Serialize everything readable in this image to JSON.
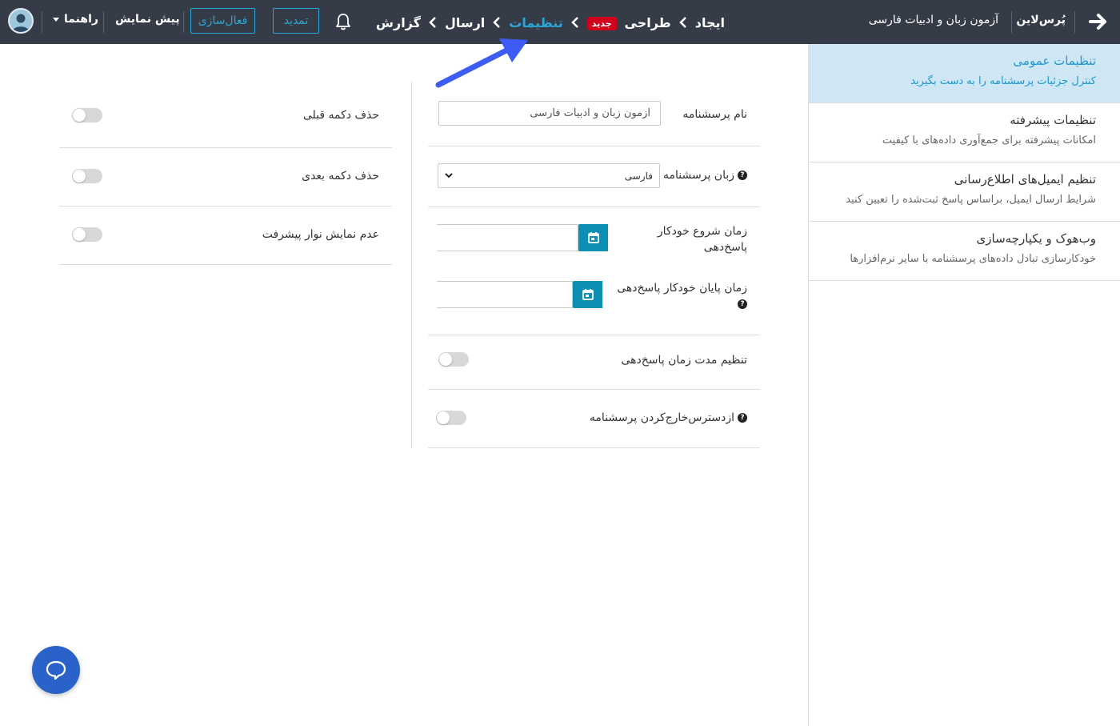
{
  "topbar": {
    "brand": "پُرس‌لاین",
    "survey_title": "آزمون زبان و ادبیات فارسی",
    "steps": {
      "create": "ایجاد",
      "design": "طراحی",
      "design_badge": "جدید",
      "settings": "تنظیمات",
      "send": "ارسال",
      "report": "گزارش"
    },
    "renew_label": "تمدید",
    "activate_label": "فعال‌سازی",
    "preview_label": "پیش نمایش",
    "help_label": "راهنما"
  },
  "sidebar": {
    "items": [
      {
        "title": "تنظیمات عمومی",
        "desc": "کنترل جزئیات پرسشنامه را به دست بگیرید"
      },
      {
        "title": "تنظیمات پیشرفته",
        "desc": "امکانات پیشرفته برای جمع‌آوری داده‌های با کیفیت"
      },
      {
        "title": "تنظیم ایمیل‌های اطلاع‌رسانی",
        "desc": "شرایط ارسال ایمیل، براساس پاسخ ثبت‌شده را تعیین کنید"
      },
      {
        "title": "وب‌هوک و یکپارچه‌سازی",
        "desc": "خودکارسازی تبادل داده‌های پرسشنامه با سایر نرم‌افزارها"
      }
    ]
  },
  "form": {
    "name_label": "نام پرسشنامه",
    "name_value": "آزمون زبان و ادبیات فارسی",
    "language_label": "زبان پرسشنامه",
    "language_value": "فارسی",
    "start_label": "زمان شروع خودکار پاسخ‌دهی",
    "end_label": "زمان پایان خودکار پاسخ‌دهی",
    "duration_label": "تنظیم مدت زمان پاسخ‌دهی",
    "unavailable_label": "ازدسترس‌خارج‌کردن پرسشنامه"
  },
  "options": {
    "remove_prev_label": "حذف دکمه قبلی",
    "remove_next_label": "حذف دکمه بعدی",
    "hide_progress_label": "عدم نمایش نوار پیشرفت"
  },
  "toggles": {
    "duration": false,
    "unavailable": false,
    "remove_prev": false,
    "remove_next": false,
    "hide_progress": false
  },
  "colors": {
    "topbar": "#353c48",
    "accent": "#2aa7d6",
    "annotation_arrow": "#3d5cf5",
    "chat_button": "#2a62c9",
    "calendar_button": "#0d8fb3"
  },
  "icons": {
    "back": "arrow-right-icon",
    "bell": "bell-icon",
    "calendar": "calendar-icon",
    "chat": "chat-bubble-icon",
    "help": "question-circle-icon"
  }
}
